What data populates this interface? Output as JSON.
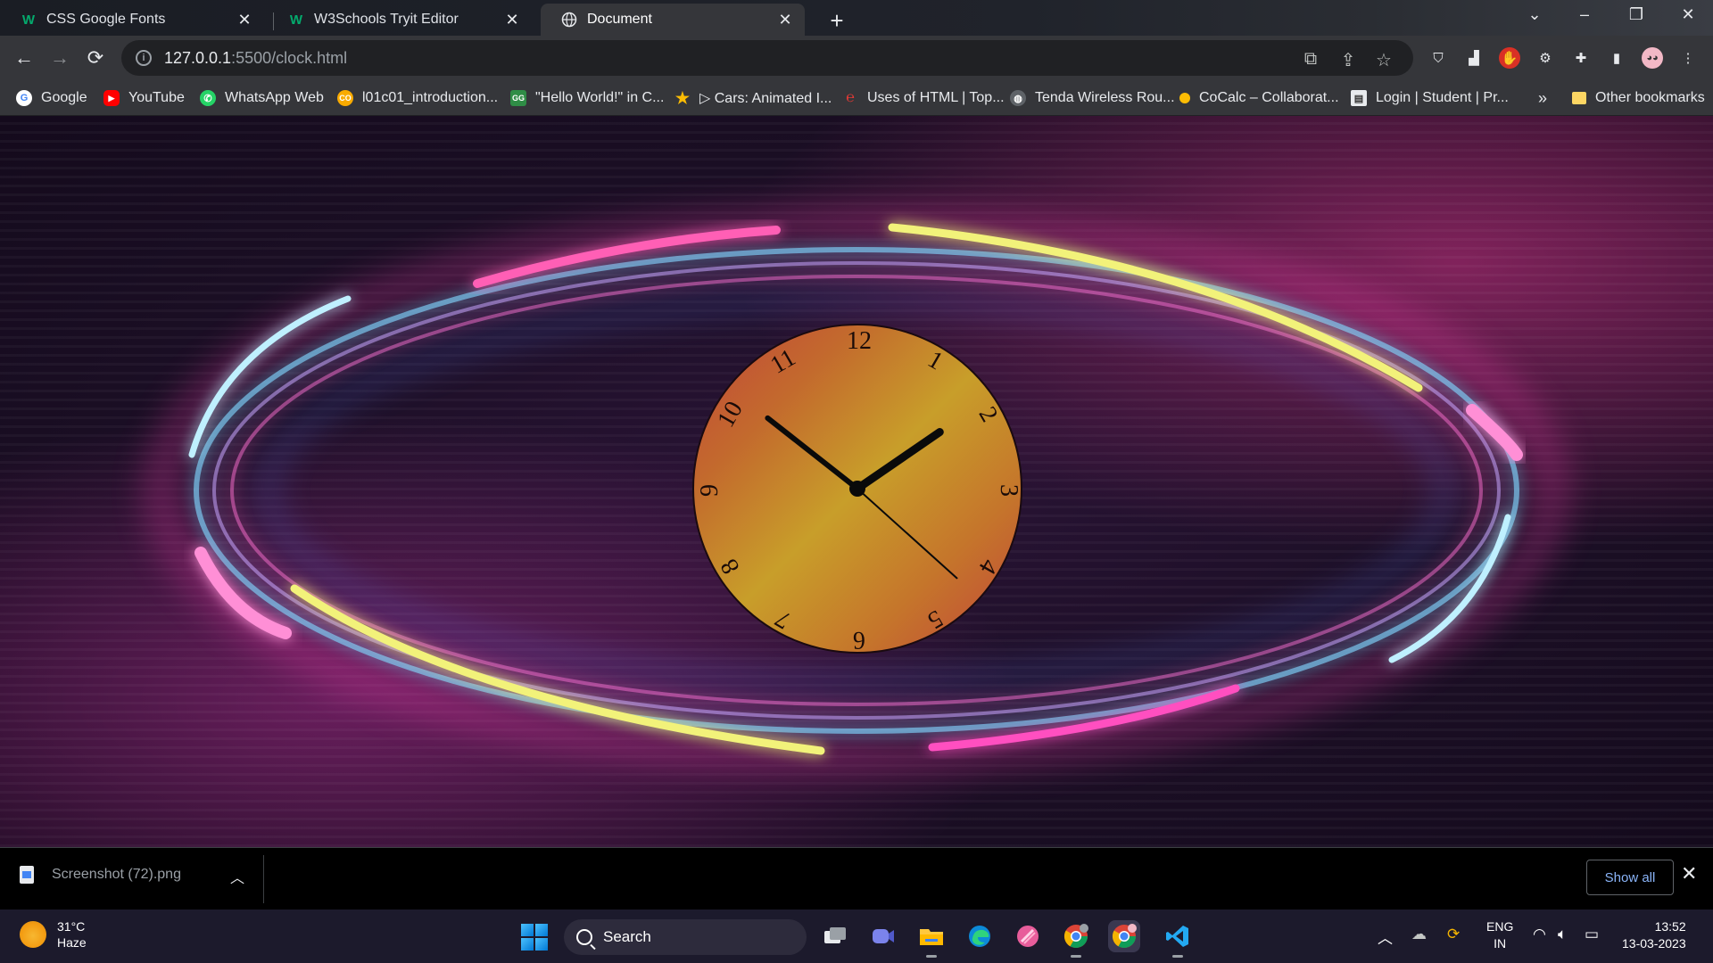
{
  "tabs": [
    {
      "title": "CSS Google Fonts",
      "favicon": "w3schools-icon"
    },
    {
      "title": "W3Schools Tryit Editor",
      "favicon": "w3schools-icon"
    },
    {
      "title": "Document",
      "favicon": "globe-icon"
    }
  ],
  "address_bar": {
    "host": "127.0.0.1",
    "path": ":5500/clock.html"
  },
  "bookmarks": [
    {
      "label": "Google",
      "icon": "google-icon",
      "color": "#4285f4"
    },
    {
      "label": "YouTube",
      "icon": "youtube-icon",
      "color": "#ff0000"
    },
    {
      "label": "WhatsApp Web",
      "icon": "whatsapp-icon",
      "color": "#25d366"
    },
    {
      "label": "l01c01_introduction...",
      "icon": "colab-icon",
      "color": "#f9ab00"
    },
    {
      "label": "\"Hello World!\" in C...",
      "icon": "gfg-icon",
      "color": "#2f8d46"
    },
    {
      "label": "▷ Cars: Animated I...",
      "icon": "star-icon",
      "color": "#fbbc04"
    },
    {
      "label": "Uses of HTML | Top...",
      "icon": "edureka-icon",
      "color": "#e53935"
    },
    {
      "label": "Tenda Wireless Rou...",
      "icon": "globe-icon",
      "color": "#9aa0a6"
    },
    {
      "label": "CoCalc – Collaborat...",
      "icon": "cocalc-icon",
      "color": "#fbbc04"
    },
    {
      "label": "Login | Student | Pr...",
      "icon": "page-icon",
      "color": "#e8eaed"
    }
  ],
  "bookmarks_overflow": "»",
  "other_bookmarks": "Other bookmarks",
  "clock": {
    "numerals": [
      "12",
      "1",
      "2",
      "3",
      "4",
      "5",
      "6",
      "7",
      "8",
      "9",
      "10",
      "11"
    ],
    "hour": 1,
    "minute": 51,
    "second": 22,
    "face_colors": [
      "#c2453a",
      "#c89e2a"
    ]
  },
  "downloads": {
    "file": "Screenshot (72).png",
    "show_all": "Show all"
  },
  "taskbar": {
    "temperature": "31°C",
    "condition": "Haze",
    "search_label": "Search",
    "language": "ENG",
    "region": "IN",
    "time": "13:52",
    "date": "13-03-2023"
  }
}
